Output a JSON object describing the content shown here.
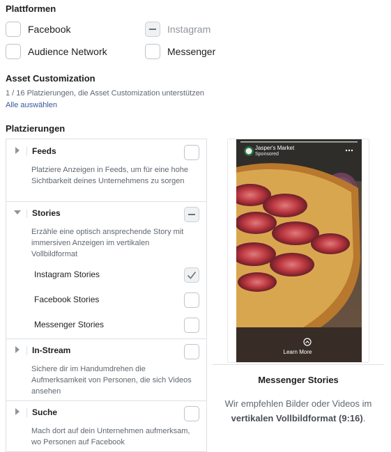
{
  "platforms": {
    "heading": "Plattformen",
    "items": [
      {
        "label": "Facebook",
        "state": "unchecked"
      },
      {
        "label": "Instagram",
        "state": "indeterminate-disabled"
      },
      {
        "label": "Audience Network",
        "state": "unchecked"
      },
      {
        "label": "Messenger",
        "state": "unchecked"
      }
    ]
  },
  "asset_customization": {
    "heading": "Asset Customization",
    "summary": "1 / 16 Platzierungen, die Asset Customization unterstützen",
    "select_all": "Alle auswählen"
  },
  "placements": {
    "heading": "Platzierungen",
    "sections": [
      {
        "title": "Feeds",
        "expanded": false,
        "state": "unchecked",
        "description": "Platziere Anzeigen in Feeds, um für eine hohe Sichtbarkeit deines Unternehmens zu sorgen"
      },
      {
        "title": "Stories",
        "expanded": true,
        "state": "indeterminate",
        "description": "Erzähle eine optisch ansprechende Story mit immersiven Anzeigen im vertikalen Vollbildformat",
        "items": [
          {
            "label": "Instagram Stories",
            "state": "checked"
          },
          {
            "label": "Facebook Stories",
            "state": "unchecked"
          },
          {
            "label": "Messenger Stories",
            "state": "unchecked"
          }
        ]
      },
      {
        "title": "In-Stream",
        "expanded": false,
        "state": "unchecked",
        "description": "Sichere dir im Handumdrehen die Aufmerksamkeit von Personen, die sich Videos ansehen"
      },
      {
        "title": "Suche",
        "expanded": false,
        "state": "unchecked",
        "description": "Mach dort auf dein Unternehmen aufmerksam, wo Personen auf Facebook"
      }
    ]
  },
  "preview": {
    "account_name": "Jasper's Market",
    "sponsored": "Sponsored",
    "cta": "Learn More",
    "title": "Messenger Stories",
    "recommendation_prefix": "Wir empfehlen Bilder oder Videos im ",
    "recommendation_bold": "vertikalen Vollbildformat (9:16)",
    "recommendation_suffix": "."
  },
  "colors": {
    "link": "#385898",
    "border": "#dddfe2",
    "text": "#1c1e21",
    "muted": "#606770"
  }
}
